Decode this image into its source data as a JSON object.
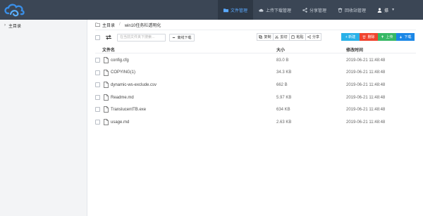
{
  "colors": {
    "topbar": "#3b4655",
    "accent": "#5aa9ff",
    "new": "#29b1e8",
    "delete": "#f0432e",
    "upload": "#37b865",
    "download": "#1b87e6"
  },
  "nav": [
    {
      "label": "文件管理",
      "icon": "folder-icon",
      "active": true
    },
    {
      "label": "上传下载管理",
      "icon": "cloud-icon",
      "active": false
    },
    {
      "label": "分享管理",
      "icon": "share-icon",
      "active": false
    },
    {
      "label": "回收站管理",
      "icon": "trash-icon",
      "active": false
    }
  ],
  "user": {
    "name": "搽",
    "icon": "user-icon"
  },
  "sidebar": {
    "root_label": "主目录"
  },
  "breadcrumb": {
    "root": "主目录",
    "sep": "/",
    "current": "win10任务栏透明化"
  },
  "toolbar": {
    "search_placeholder": "在当前文件夹下搜索...",
    "offline_label": "离线下载",
    "copy_label": "复制",
    "cut_label": "剪切",
    "paste_label": "粘贴",
    "share_label": "分享",
    "new_label": "+ 新建",
    "delete_label": "删除",
    "upload_label": "上传",
    "download_label": "下载"
  },
  "table": {
    "headers": {
      "name": "文件名",
      "size": "大小",
      "time": "修改时间"
    },
    "rows": [
      {
        "name": "config.cfg",
        "size": "83.0 B",
        "time": "2019-06-21 11:48:48"
      },
      {
        "name": "COPYING(1)",
        "size": "34.3 KB",
        "time": "2019-06-21 11:48:48"
      },
      {
        "name": "dynamic-ws-exclude.csv",
        "size": "662 B",
        "time": "2019-06-21 11:48:48"
      },
      {
        "name": "Readme.md",
        "size": "5.97 KB",
        "time": "2019-06-21 11:48:48"
      },
      {
        "name": "TranslucentTB.exe",
        "size": "634 KB",
        "time": "2019-06-21 11:48:48"
      },
      {
        "name": "usage.md",
        "size": "2.63 KB",
        "time": "2019-06-21 11:48:48"
      }
    ]
  }
}
